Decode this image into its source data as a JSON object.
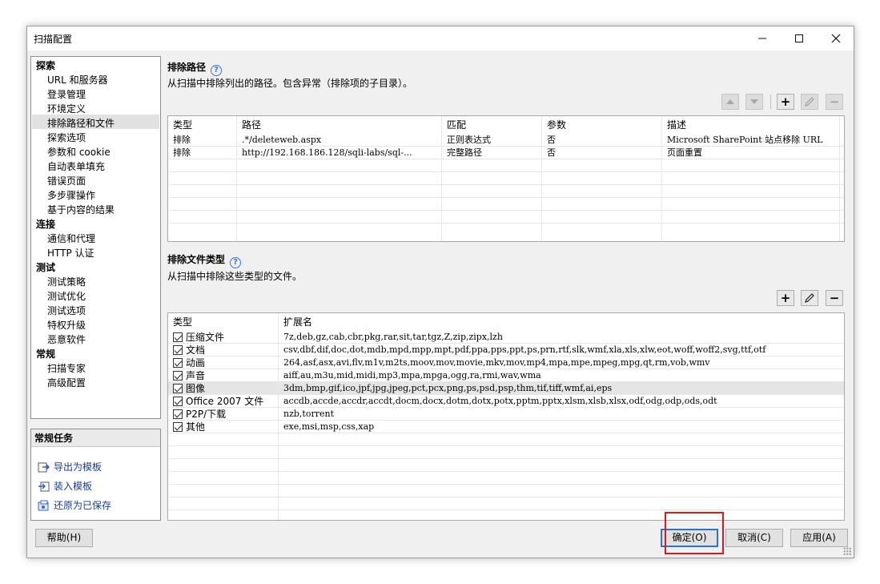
{
  "window": {
    "title": "扫描配置"
  },
  "nav": {
    "categories": [
      {
        "label": "探索",
        "items": [
          "URL 和服务器",
          "登录管理",
          "环境定义",
          "排除路径和文件",
          "探索选项",
          "参数和 cookie",
          "自动表单填充",
          "错误页面",
          "多步骤操作",
          "基于内容的结果"
        ]
      },
      {
        "label": "连接",
        "items": [
          "通信和代理",
          "HTTP 认证"
        ]
      },
      {
        "label": "测试",
        "items": [
          "测试策略",
          "测试优化",
          "测试选项",
          "特权升级",
          "恶意软件"
        ]
      },
      {
        "label": "常规",
        "items": [
          "扫描专家",
          "高级配置"
        ]
      }
    ],
    "selected": "排除路径和文件"
  },
  "tasks": {
    "header": "常规任务",
    "links": [
      "导出为模板",
      "装入模板",
      "还原为已保存"
    ]
  },
  "exclude_paths": {
    "title": "排除路径",
    "description": "从扫描中排除列出的路径。包含异常（排除项的子目录）。",
    "headers": [
      "类型",
      "路径",
      "匹配",
      "参数",
      "描述"
    ],
    "rows": [
      [
        "排除",
        ".*/deleteweb.aspx",
        "正则表达式",
        "否",
        "Microsoft SharePoint 站点移除 URL"
      ],
      [
        "排除",
        "http://192.168.186.128/sqli-labs/sql-...",
        "完整路径",
        "否",
        "页面重置"
      ]
    ]
  },
  "exclude_filetypes": {
    "title": "排除文件类型",
    "description": "从扫描中排除这些类型的文件。",
    "headers": [
      "类型",
      "扩展名"
    ],
    "rows": [
      [
        "压缩文件",
        "7z,deb,gz,cab,cbr,pkg,rar,sit,tar,tgz,Z,zip,zipx,lzh"
      ],
      [
        "文档",
        "csv,dbf,dif,doc,dot,mdb,mpd,mpp,mpt,pdf,ppa,pps,ppt,ps,prn,rtf,slk,wmf,xla,xls,xlw,eot,woff,woff2,svg,ttf,otf"
      ],
      [
        "动画",
        "264,asf,asx,avi,flv,m1v,m2ts,moov,mov,movie,mkv,mov,mp4,mpa,mpe,mpeg,mpg,qt,rm,vob,wmv"
      ],
      [
        "声音",
        "aiff,au,m3u,mid,midi,mp3,mpa,mpga,ogg,ra,rmi,wav,wma"
      ],
      [
        "图像",
        "3dm,bmp,gif,ico,jpf,jpg,jpeg,pct,pcx,png,ps,psd,psp,thm,tif,tiff,wmf,ai,eps"
      ],
      [
        "Office 2007 文件",
        "accdb,accde,accdr,accdt,docm,docx,dotm,dotx,potx,pptm,pptx,xlsm,xlsb,xlsx,odf,odg,odp,ods,odt"
      ],
      [
        "P2P/下载",
        "nzb,torrent"
      ],
      [
        "其他",
        "exe,msi,msp,css,xap"
      ]
    ],
    "highlighted_row": "图像"
  },
  "buttons": {
    "help": "帮助(H)",
    "ok": "确定(O)",
    "cancel": "取消(C)",
    "apply": "应用(A)"
  },
  "icons": {
    "help": "?",
    "add": "+",
    "remove": "−",
    "minimize": "—",
    "maximize": "☐",
    "close": "✕"
  }
}
